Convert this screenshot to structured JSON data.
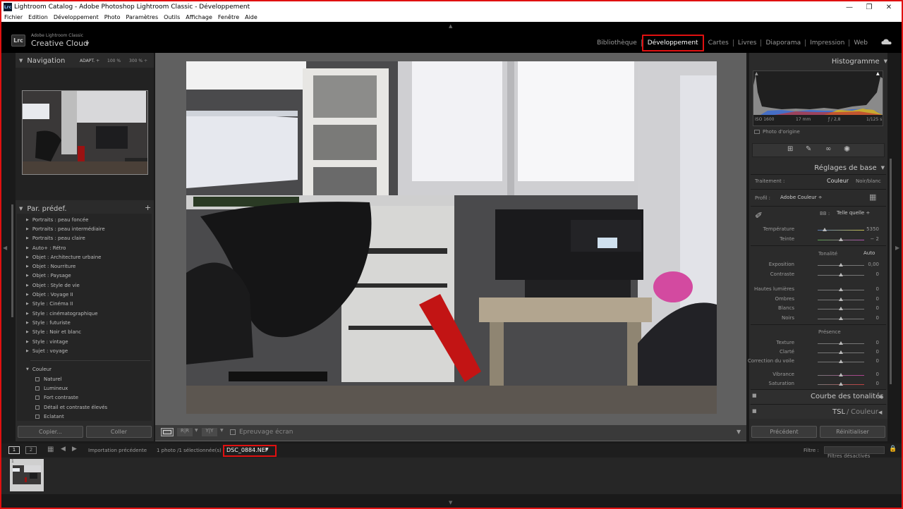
{
  "window": {
    "title": "Lightroom Catalog - Adobe Photoshop Lightroom Classic - Développement",
    "app_icon": "Lrc",
    "controls": [
      "minimize-icon",
      "maximize-icon",
      "close-icon"
    ]
  },
  "menu": [
    "Fichier",
    "Edition",
    "Développement",
    "Photo",
    "Paramètres",
    "Outils",
    "Affichage",
    "Fenêtre",
    "Aide"
  ],
  "identity": {
    "badge": "Lrc",
    "small": "Adobe Lightroom Classic",
    "big": "Creative Cloud"
  },
  "modules": [
    {
      "label": "Bibliothèque",
      "active": false
    },
    {
      "label": "Développement",
      "active": true
    },
    {
      "label": "Cartes",
      "active": false
    },
    {
      "label": "Livres",
      "active": false
    },
    {
      "label": "Diaporama",
      "active": false
    },
    {
      "label": "Impression",
      "active": false
    },
    {
      "label": "Web",
      "active": false
    }
  ],
  "navigator": {
    "title": "Navigation",
    "zoom": [
      "ADAPT. ÷",
      "100 %",
      "300 % ÷"
    ]
  },
  "presets": {
    "title": "Par. prédef.",
    "items": [
      {
        "label": "Portraits : peau foncée",
        "kind": "folder"
      },
      {
        "label": "Portraits : peau intermédiaire",
        "kind": "folder"
      },
      {
        "label": "Portraits : peau claire",
        "kind": "folder"
      },
      {
        "label": "Auto+ : Rétro",
        "kind": "folder"
      },
      {
        "label": "Objet : Architecture urbaine",
        "kind": "folder"
      },
      {
        "label": "Objet : Nourriture",
        "kind": "folder"
      },
      {
        "label": "Objet : Paysage",
        "kind": "folder"
      },
      {
        "label": "Objet : Style de vie",
        "kind": "folder"
      },
      {
        "label": "Objet : Voyage II",
        "kind": "folder"
      },
      {
        "label": "Style : Cinéma II",
        "kind": "folder"
      },
      {
        "label": "Style : cinématographique",
        "kind": "folder"
      },
      {
        "label": "Style : futuriste",
        "kind": "folder"
      },
      {
        "label": "Style : Noir et blanc",
        "kind": "folder"
      },
      {
        "label": "Style : vintage",
        "kind": "folder"
      },
      {
        "label": "Sujet : voyage",
        "kind": "folder"
      },
      {
        "label": "",
        "kind": "spacer"
      },
      {
        "label": "Couleur",
        "kind": "open"
      },
      {
        "label": "Naturel",
        "kind": "preset"
      },
      {
        "label": "Lumineux",
        "kind": "preset"
      },
      {
        "label": "Fort contraste",
        "kind": "preset"
      },
      {
        "label": "Détail et contraste élevés",
        "kind": "preset"
      },
      {
        "label": "Eclatant",
        "kind": "preset"
      }
    ]
  },
  "left_buttons": {
    "copy": "Copier...",
    "paste": "Coller"
  },
  "histogram": {
    "title": "Histogramme",
    "iso": "ISO 1600",
    "focal": "17 mm",
    "aperture": "ƒ / 2,8",
    "shutter": "1/125 s",
    "original": "Photo d'origine"
  },
  "basic": {
    "title": "Réglages de base",
    "treatment_label": "Traitement :",
    "color": "Couleur",
    "bw": "Noir/blanc",
    "profile_label": "Profil :",
    "profile": "Adobe Couleur ÷",
    "wb_label": "BB :",
    "wb_value": "Telle quelle ÷",
    "tonality": "Tonalité",
    "auto": "Auto",
    "presence": "Présence",
    "sliders": [
      {
        "label": "Température",
        "value": "5350",
        "pos": 0.15,
        "group": "wb"
      },
      {
        "label": "Teinte",
        "value": "− 2",
        "pos": 0.5,
        "group": "wb"
      },
      {
        "label": "Exposition",
        "value": "0,00",
        "pos": 0.5,
        "group": "tone1"
      },
      {
        "label": "Contraste",
        "value": "0",
        "pos": 0.5,
        "group": "tone1"
      },
      {
        "label": "Hautes lumières",
        "value": "0",
        "pos": 0.5,
        "group": "tone2"
      },
      {
        "label": "Ombres",
        "value": "0",
        "pos": 0.5,
        "group": "tone2"
      },
      {
        "label": "Blancs",
        "value": "0",
        "pos": 0.5,
        "group": "tone2"
      },
      {
        "label": "Noirs",
        "value": "0",
        "pos": 0.5,
        "group": "tone2"
      },
      {
        "label": "Texture",
        "value": "0",
        "pos": 0.5,
        "group": "pres1"
      },
      {
        "label": "Clarté",
        "value": "0",
        "pos": 0.5,
        "group": "pres1"
      },
      {
        "label": "Correction du voile",
        "value": "0",
        "pos": 0.5,
        "group": "pres1"
      },
      {
        "label": "Vibrance",
        "value": "0",
        "pos": 0.5,
        "group": "pres2"
      },
      {
        "label": "Saturation",
        "value": "0",
        "pos": 0.5,
        "group": "pres2"
      }
    ]
  },
  "curve_title": "Courbe des tonalités",
  "tsl_title": "TSL",
  "tsl_sub": "Couleur",
  "right_buttons": {
    "previous": "Précédent",
    "reset": "Réinitialiser"
  },
  "toolbar": {
    "proof": "Epreuvage écran"
  },
  "filmbar": {
    "tab1": "1",
    "tab2": "2",
    "source": "Importation précédente",
    "count": "1 photo /1 sélectionnée(s) /",
    "filename": "DSC_0884.NEF",
    "filter_label": "Filtre :",
    "filter_value": "Filtres désactivés"
  },
  "film_thumb_index": "1"
}
